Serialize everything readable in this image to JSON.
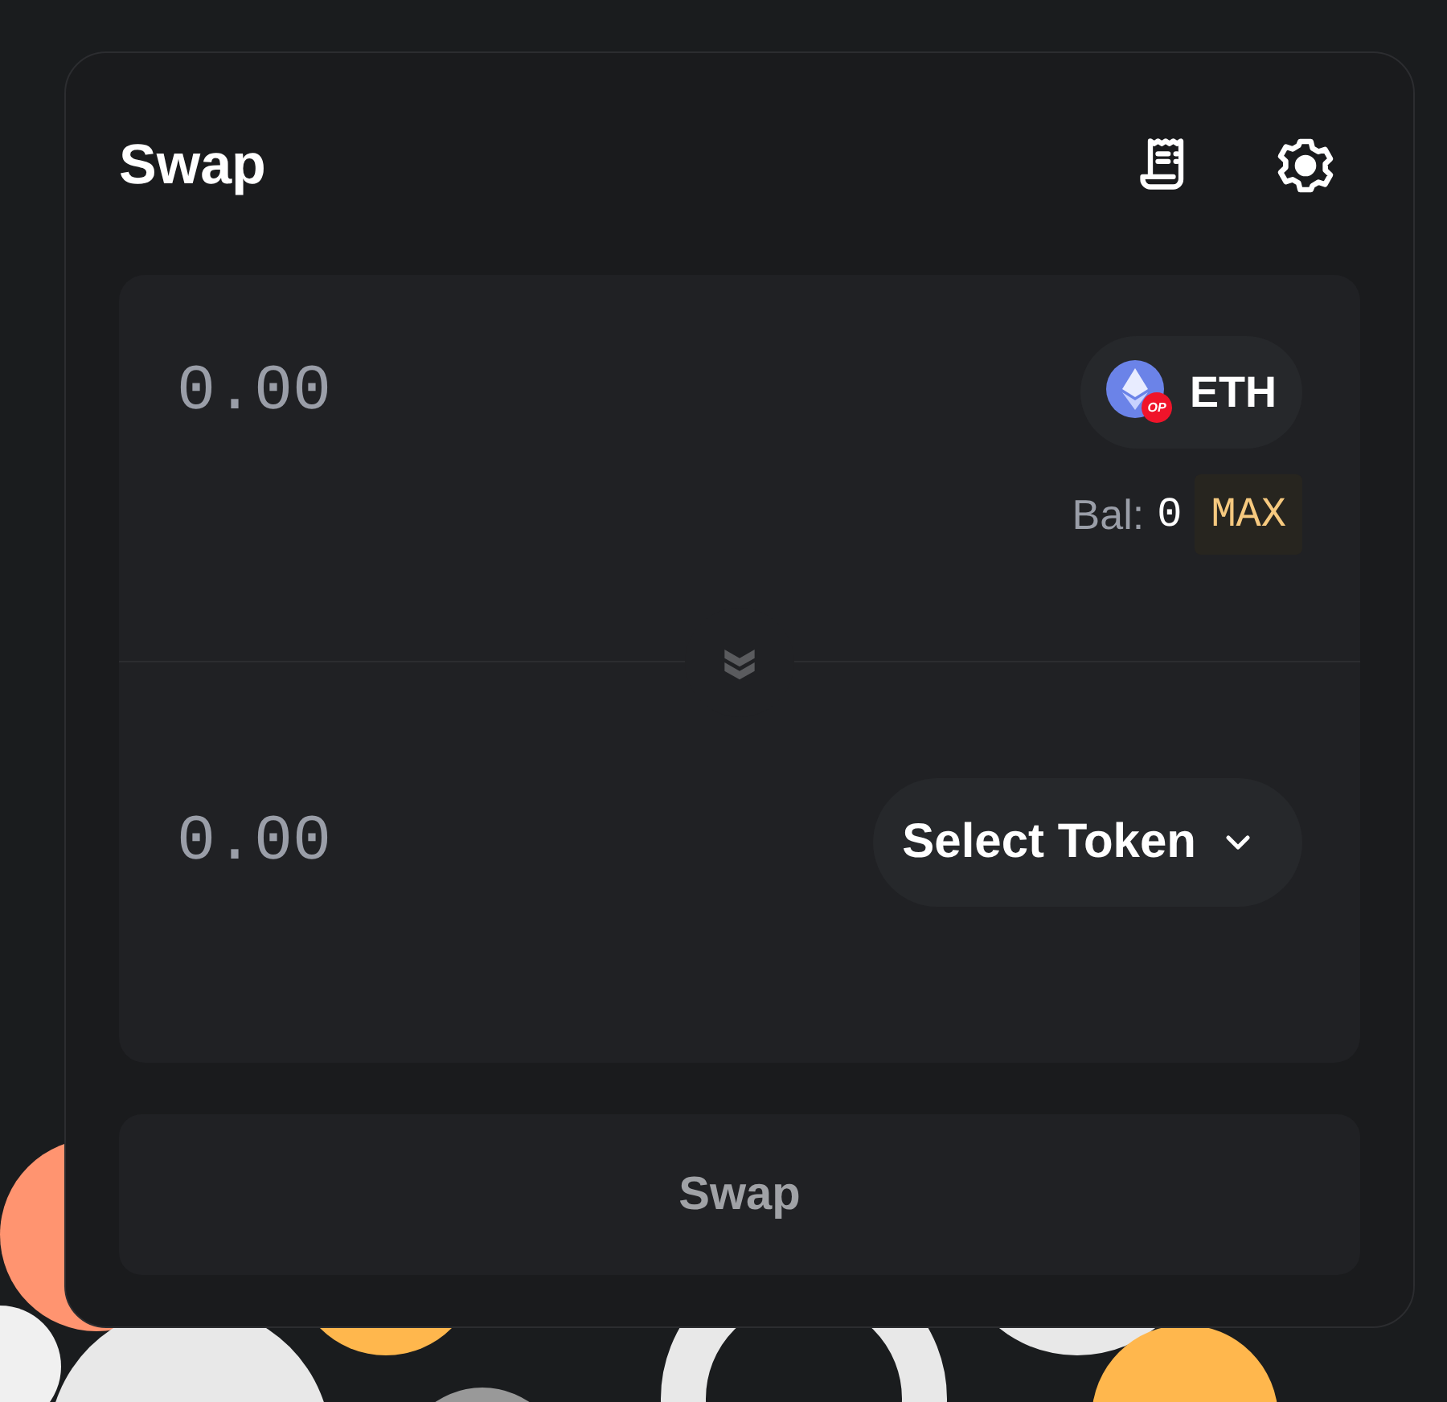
{
  "title": "Swap",
  "from": {
    "placeholder": "0.00",
    "token": "ETH",
    "network_badge": "OP",
    "balance_label": "Bal:",
    "balance": "0",
    "max": "MAX"
  },
  "to": {
    "placeholder": "0.00",
    "select_label": "Select Token"
  },
  "swap_button": {
    "label": "Swap",
    "disabled": true
  }
}
